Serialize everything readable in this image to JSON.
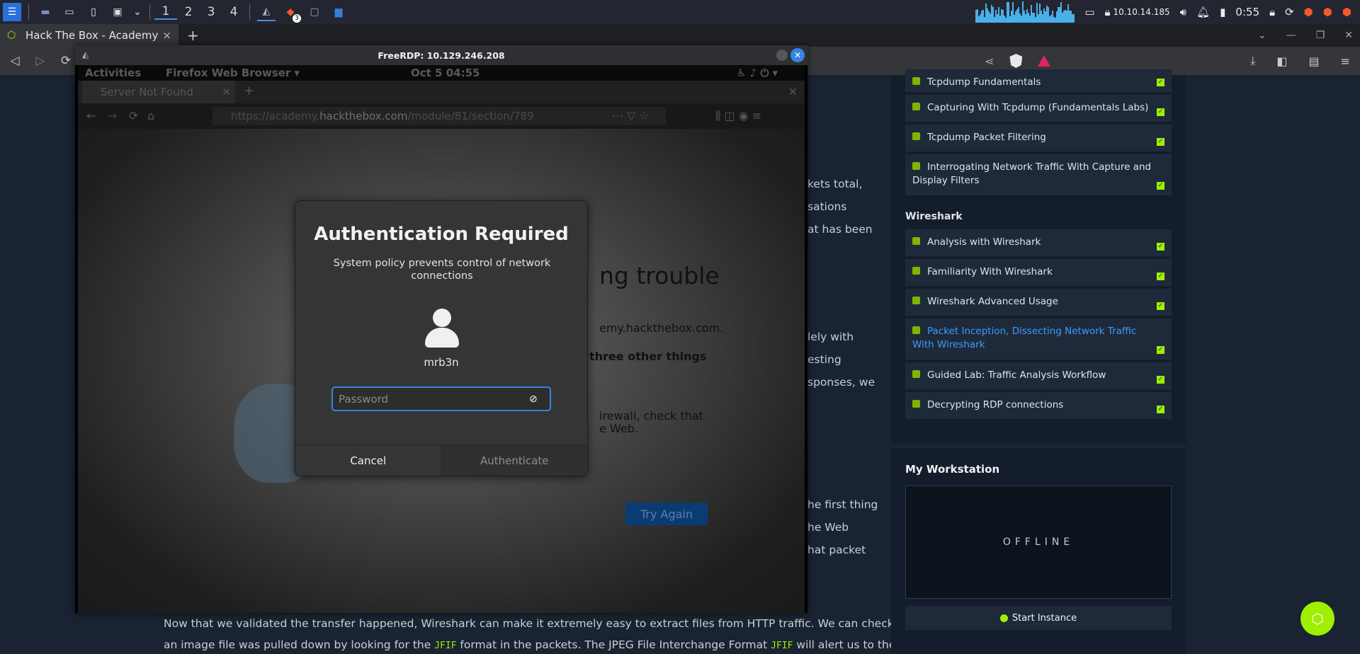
{
  "taskbar": {
    "workspaces": [
      "1",
      "2",
      "3",
      "4"
    ],
    "badge": "3",
    "ip": "10.10.14.185",
    "clock": "0:55"
  },
  "browser": {
    "tab_title": "Hack The Box - Academy",
    "new_tab": "+",
    "tab_close": "×"
  },
  "page": {
    "right_frags": [
      "kets total,",
      "sations",
      "at has been",
      "lely with",
      "esting",
      "sponses, we",
      "he first thing",
      "he Web",
      "hat packet"
    ],
    "bottom_line1": "Now that we validated the transfer happened, Wireshark can make it extremely easy to extract files from HTTP traffic. We can check to see if",
    "bottom_line2_a": "an image file was pulled down by looking for the ",
    "bottom_code1": "JFIF",
    "bottom_line2_b": " format in the packets. The JPEG File Interchange Format ",
    "bottom_code2": "JFIF",
    "bottom_line2_c": " will alert us to the"
  },
  "sidebar": {
    "items_top": [
      "Tcpdump Fundamentals",
      "Capturing With Tcpdump (Fundamentals Labs)",
      "Tcpdump Packet Filtering",
      "Interrogating Network Traffic With Capture and Display Filters"
    ],
    "section": "Wireshark",
    "items_ws": [
      "Analysis with Wireshark",
      "Familiarity With Wireshark",
      "Wireshark Advanced Usage",
      "Packet Inception, Dissecting Network Traffic With Wireshark",
      "Guided Lab: Traffic Analysis Workflow",
      "Decrypting RDP connections"
    ],
    "check": "✓"
  },
  "workstation": {
    "title": "My Workstation",
    "status": "OFFLINE",
    "start_label": "Start Instance"
  },
  "rdp": {
    "title": "FreeRDP: 10.129.246.208",
    "gnome": {
      "activities": "Activities",
      "app": "Firefox Web Browser ▾",
      "clock": "Oct 5  04:55"
    },
    "ff_tab": "Server Not Found",
    "url_prefix": "https://academy.",
    "url_host": "hackthebox.com",
    "url_path": "/module/81/section/789",
    "content": {
      "heading_frag": "ng trouble",
      "host_frag": "emy.hackthebox.com.",
      "bold_frag": "three other things",
      "firewall_frag": "irewall, check that",
      "web_frag": "e Web.",
      "try_again": "Try Again"
    }
  },
  "auth": {
    "title": "Authentication Required",
    "message": "System policy prevents control of network connections",
    "user": "mrb3n",
    "password_placeholder": "Password",
    "cancel": "Cancel",
    "authenticate": "Authenticate"
  },
  "colors": {
    "accent_blue": "#3584e4",
    "htb_green": "#9fef00",
    "active_link": "#3d9bff"
  }
}
